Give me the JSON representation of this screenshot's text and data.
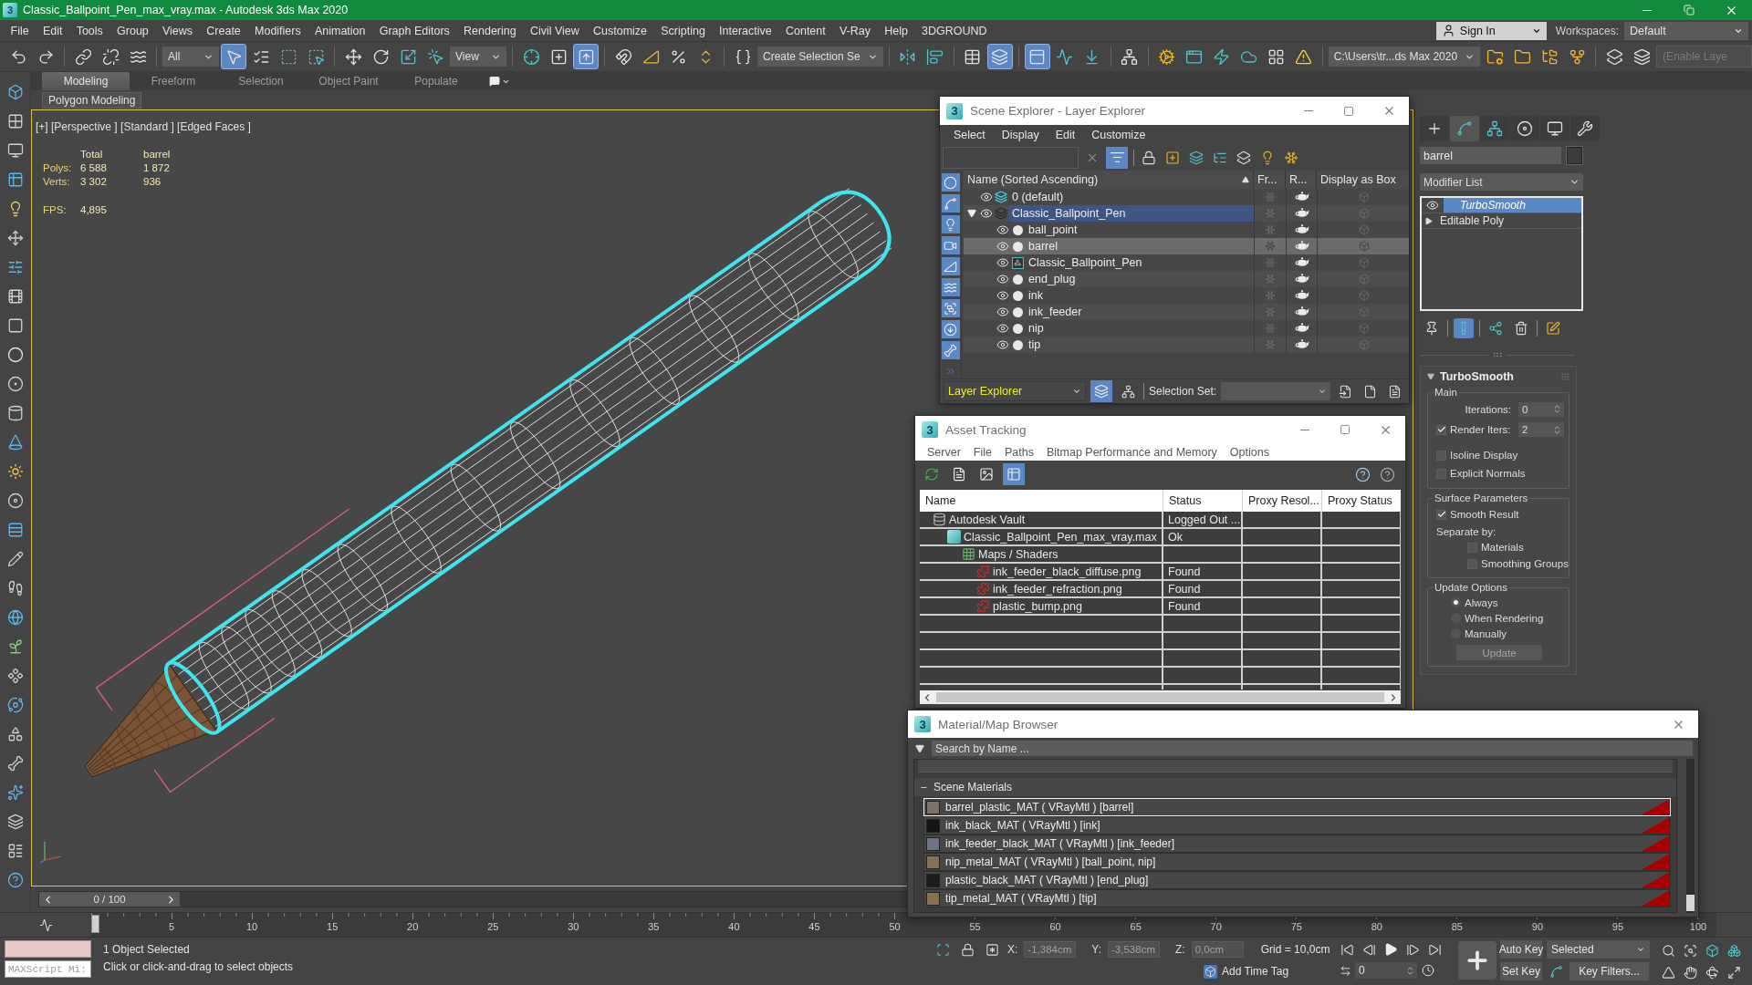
{
  "window": {
    "logo": "3",
    "title": "Classic_Ballpoint_Pen_max_vray.max - Autodesk 3ds Max 2020"
  },
  "menu_bar": {
    "items": [
      "File",
      "Edit",
      "Tools",
      "Group",
      "Views",
      "Create",
      "Modifiers",
      "Animation",
      "Graph Editors",
      "Rendering",
      "Civil View",
      "Customize",
      "Scripting",
      "Interactive",
      "Content",
      "V-Ray",
      "Help",
      "3DGROUND"
    ],
    "sign_in": "Sign In",
    "workspaces_label": "Workspaces:",
    "workspace": "Default"
  },
  "main_toolbar": {
    "groups": [
      [
        {
          "kind": "undo",
          "selected": false
        },
        {
          "kind": "redo",
          "selected": false
        }
      ],
      [
        {
          "kind": "link",
          "selected": false
        },
        {
          "kind": "unlink",
          "selected": false
        },
        {
          "kind": "bind",
          "selected": false
        }
      ],
      [
        {
          "kind": "dropdown",
          "value": "All"
        },
        {
          "kind": "select",
          "selected": true
        },
        {
          "kind": "select_by_name",
          "selected": false
        },
        {
          "kind": "region",
          "selected": false
        },
        {
          "kind": "crossing",
          "selected": false
        }
      ],
      [
        {
          "kind": "move",
          "selected": false
        },
        {
          "kind": "rotate",
          "selected": false
        },
        {
          "kind": "scale",
          "selected": false
        },
        {
          "kind": "place",
          "selected": false
        },
        {
          "kind": "dropdown",
          "value": "View"
        }
      ],
      [
        {
          "kind": "pivot",
          "selected": false
        },
        {
          "kind": "manipulate",
          "selected": false
        },
        {
          "kind": "shortcut",
          "selected": true
        }
      ],
      [
        {
          "kind": "snap",
          "selected": false
        },
        {
          "kind": "angle_snap",
          "selected": false
        },
        {
          "kind": "percent_snap",
          "selected": false
        },
        {
          "kind": "spinner_snap",
          "selected": false
        }
      ],
      [
        {
          "kind": "named_sets",
          "selected": false
        },
        {
          "kind": "dropdown",
          "value": "Create Selection Se"
        }
      ],
      [
        {
          "kind": "mirror",
          "selected": false
        },
        {
          "kind": "align",
          "selected": false
        }
      ],
      [
        {
          "kind": "scene_explorer",
          "selected": false
        },
        {
          "kind": "layer_explorer",
          "selected": true
        }
      ],
      [
        {
          "kind": "ribbon",
          "selected": true
        },
        {
          "kind": "curve_editor",
          "selected": false
        },
        {
          "kind": "dope_sheet",
          "selected": false
        }
      ],
      [
        {
          "kind": "schematic",
          "selected": false
        }
      ],
      [
        {
          "kind": "render_setup",
          "selected": false
        },
        {
          "kind": "frame_window",
          "selected": false
        },
        {
          "kind": "render",
          "selected": false
        },
        {
          "kind": "render_cloud",
          "selected": false
        },
        {
          "kind": "gallery",
          "selected": false
        },
        {
          "kind": "warning",
          "selected": false
        }
      ],
      [
        {
          "kind": "dropdown",
          "value": "C:\\Users\\tr...ds Max 2020"
        },
        {
          "kind": "project_folder",
          "selected": false
        },
        {
          "kind": "folder",
          "selected": false
        },
        {
          "kind": "tree",
          "selected": false
        },
        {
          "kind": "tree_alt",
          "selected": false
        }
      ],
      [
        {
          "kind": "layers",
          "selected": false
        },
        {
          "kind": "layers_alt",
          "selected": false
        },
        {
          "kind": "field",
          "placeholder": "(Enable Laye"
        }
      ]
    ]
  },
  "ribbon": {
    "tabs": [
      {
        "label": "Modeling",
        "selected": true
      },
      {
        "label": "Freeform",
        "selected": false
      },
      {
        "label": "Selection",
        "selected": false
      },
      {
        "label": "Object Paint",
        "selected": false
      },
      {
        "label": "Populate",
        "selected": false
      }
    ],
    "panel": "Polygon Modeling"
  },
  "viewport": {
    "label": "[+] [Perspective ] [Standard ] [Edged Faces ]",
    "active": true,
    "stats": {
      "headers": [
        "Total",
        "barrel"
      ],
      "rows": [
        {
          "label": "Polys:",
          "values": [
            "6 588",
            "1 872"
          ]
        },
        {
          "label": "Verts:",
          "values": [
            "3 302",
            "936"
          ]
        },
        {
          "label": "FPS:",
          "values": [
            "4,895"
          ]
        }
      ]
    }
  },
  "time_slider": {
    "label": "0 / 100",
    "level": 0
  },
  "track_bar": {
    "ticks": [
      "5",
      "10",
      "15",
      "20",
      "25",
      "30",
      "35",
      "40",
      "45",
      "50",
      "55",
      "60",
      "65",
      "70",
      "75",
      "80",
      "85",
      "90",
      "95",
      "100"
    ]
  },
  "command_panel": {
    "tabs": [
      {
        "kind": "create",
        "selected": false
      },
      {
        "kind": "modify",
        "selected": true
      },
      {
        "kind": "hierarchy",
        "selected": false
      },
      {
        "kind": "motion",
        "selected": false
      },
      {
        "kind": "display",
        "selected": false
      },
      {
        "kind": "utilities",
        "selected": false
      }
    ],
    "object_name": "barrel",
    "modifier_list": "Modifier List",
    "stack": [
      {
        "kind": "modifier",
        "name": "TurboSmooth",
        "selected": true,
        "on": true
      },
      {
        "kind": "base",
        "name": "Editable Poly",
        "selected": false,
        "expanded": false
      }
    ],
    "stack_tools": [
      {
        "kind": "pin",
        "selected": false
      },
      {
        "kind": "show_end_result",
        "selected": true
      },
      {
        "kind": "make_unique",
        "selected": false
      },
      {
        "kind": "remove",
        "selected": false
      },
      {
        "kind": "configure",
        "selected": false
      }
    ],
    "rollout": {
      "title": "TurboSmooth",
      "expanded": true,
      "groups": [
        {
          "title": "Main",
          "controls": [
            {
              "kind": "spinner",
              "label": "Iterations:",
              "value": "0"
            },
            {
              "kind": "check_spinner",
              "label": "Render Iters:",
              "checked": true,
              "value": "2"
            },
            {
              "kind": "checkbox",
              "label": "Isoline Display",
              "checked": false
            },
            {
              "kind": "checkbox",
              "label": "Explicit Normals",
              "checked": false
            }
          ]
        },
        {
          "title": "Surface Parameters",
          "controls": [
            {
              "kind": "checkbox",
              "label": "Smooth Result",
              "checked": true
            },
            {
              "kind": "label",
              "label": "Separate by:"
            },
            {
              "kind": "sub_checkbox",
              "label": "Materials",
              "checked": false
            },
            {
              "kind": "sub_checkbox",
              "label": "Smoothing Groups",
              "checked": false
            }
          ]
        },
        {
          "title": "Update Options",
          "controls": [
            {
              "kind": "radio",
              "label": "Always",
              "selected": true
            },
            {
              "kind": "radio",
              "label": "When Rendering",
              "selected": false
            },
            {
              "kind": "radio",
              "label": "Manually",
              "selected": false
            },
            {
              "kind": "button",
              "label": "Update",
              "disabled": true
            }
          ]
        }
      ]
    }
  },
  "scene_explorer": {
    "logo": "3",
    "title": "Scene Explorer - Layer Explorer",
    "menu": [
      "Select",
      "Display",
      "Edit",
      "Customize"
    ],
    "filter_on": true,
    "filters": [
      {
        "kind": "geometry",
        "on": true
      },
      {
        "kind": "shapes",
        "on": true
      },
      {
        "kind": "lights",
        "on": true
      },
      {
        "kind": "cameras",
        "on": true
      },
      {
        "kind": "helpers",
        "on": true
      },
      {
        "kind": "space_warps",
        "on": true
      },
      {
        "kind": "groups",
        "on": true
      },
      {
        "kind": "xrefs",
        "on": true
      },
      {
        "kind": "bones",
        "on": true
      }
    ],
    "columns": [
      "Name (Sorted Ascending)",
      "Fr...",
      "R...",
      "Display as Box"
    ],
    "sort_ascending": true,
    "layers": [
      {
        "name": "0 (default)",
        "current": true,
        "selected": false,
        "expanded": false,
        "visible": true,
        "frozen": false,
        "renderable": true,
        "display_as_box": false
      },
      {
        "name": "Classic_Ballpoint_Pen",
        "current": false,
        "selected": true,
        "expanded": true,
        "visible": true,
        "frozen": false,
        "renderable": true,
        "display_as_box": false,
        "children": [
          {
            "kind": "object",
            "name": "ball_point",
            "selected": false,
            "visible": true,
            "frozen": false,
            "renderable": true,
            "display_as_box": false
          },
          {
            "kind": "object",
            "name": "barrel",
            "selected": true,
            "visible": true,
            "frozen": false,
            "renderable": true,
            "display_as_box": false
          },
          {
            "kind": "group",
            "name": "Classic_Ballpoint_Pen",
            "selected": false,
            "visible": true,
            "frozen": false,
            "renderable": true,
            "display_as_box": false
          },
          {
            "kind": "object",
            "name": "end_plug",
            "selected": false,
            "visible": true,
            "frozen": false,
            "renderable": true,
            "display_as_box": false
          },
          {
            "kind": "object",
            "name": "ink",
            "selected": false,
            "visible": true,
            "frozen": false,
            "renderable": true,
            "display_as_box": false
          },
          {
            "kind": "object",
            "name": "ink_feeder",
            "selected": false,
            "visible": true,
            "frozen": false,
            "renderable": true,
            "display_as_box": false
          },
          {
            "kind": "object",
            "name": "nip",
            "selected": false,
            "visible": true,
            "frozen": false,
            "renderable": true,
            "display_as_box": false
          },
          {
            "kind": "object",
            "name": "tip",
            "selected": false,
            "visible": true,
            "frozen": false,
            "renderable": true,
            "display_as_box": false
          }
        ]
      }
    ],
    "explorer": "Layer Explorer",
    "layer_mode_on": true,
    "selection_set_label": "Selection Set:"
  },
  "asset_tracking": {
    "logo": "3",
    "title": "Asset Tracking",
    "menu": [
      "Server",
      "File",
      "Paths",
      "Bitmap Performance and Memory",
      "Options"
    ],
    "views": [
      {
        "kind": "refresh",
        "selected": false
      },
      {
        "kind": "list",
        "selected": false
      },
      {
        "kind": "thumbnails",
        "selected": false
      },
      {
        "kind": "table",
        "selected": true
      }
    ],
    "columns": [
      "Name",
      "Status",
      "Proxy Resol...",
      "Proxy Status"
    ],
    "rows": [
      {
        "kind": "vault",
        "name": "Autodesk Vault",
        "status": "Logged Out ...",
        "children": [
          {
            "kind": "scene_file",
            "name": "Classic_Ballpoint_Pen_max_vray.max",
            "status": "Ok",
            "children": [
              {
                "kind": "folder",
                "name": "Maps / Shaders",
                "children": [
                  {
                    "kind": "bitmap",
                    "name": "ink_feeder_black_diffuse.png",
                    "status": "Found"
                  },
                  {
                    "kind": "bitmap",
                    "name": "ink_feeder_refraction.png",
                    "status": "Found"
                  },
                  {
                    "kind": "bitmap",
                    "name": "plastic_bump.png",
                    "status": "Found"
                  }
                ]
              }
            ]
          }
        ]
      }
    ]
  },
  "material_browser": {
    "logo": "3",
    "title": "Material/Map Browser",
    "search_placeholder": "Search by Name ...",
    "groups": [
      {
        "name": "Scene Materials",
        "expanded": true,
        "items": [
          {
            "name": "barrel_plastic_MAT ( VRayMtl ) [barrel]",
            "selected": true,
            "color": "#7c7268"
          },
          {
            "name": "ink_black_MAT ( VRayMtl ) [ink]",
            "selected": false,
            "color": "#141414"
          },
          {
            "name": "ink_feeder_black_MAT ( VRayMtl ) [ink_feeder]",
            "selected": false,
            "color": "#6d7582"
          },
          {
            "name": "nip_metal_MAT ( VRayMtl ) [ball_point, nip]",
            "selected": false,
            "color": "#8a7052"
          },
          {
            "name": "plastic_black_MAT ( VRayMtl ) [end_plug]",
            "selected": false,
            "color": "#1c1c1c"
          },
          {
            "name": "tip_metal_MAT ( VRayMtl ) [tip]",
            "selected": false,
            "color": "#86704f"
          }
        ]
      }
    ]
  },
  "status_bar": {
    "listener_placeholder": "MAXScript Mi:",
    "selection": "1 Object Selected",
    "prompt": "Click or click-and-drag to select objects",
    "coords": [
      {
        "axis": "X:",
        "value": "-1,384cm",
        "disabled": true
      },
      {
        "axis": "Y:",
        "value": "-3,538cm",
        "disabled": true
      },
      {
        "axis": "Z:",
        "value": "0,0cm",
        "disabled": true
      }
    ],
    "grid": "Grid = 10,0cm",
    "add_time_tag": "Add Time Tag",
    "frame": "0",
    "auto_key": {
      "label": "Auto Key",
      "on": false
    },
    "key_mode": "Selected",
    "set_key": "Set Key",
    "key_filters": "Key Filters..."
  }
}
